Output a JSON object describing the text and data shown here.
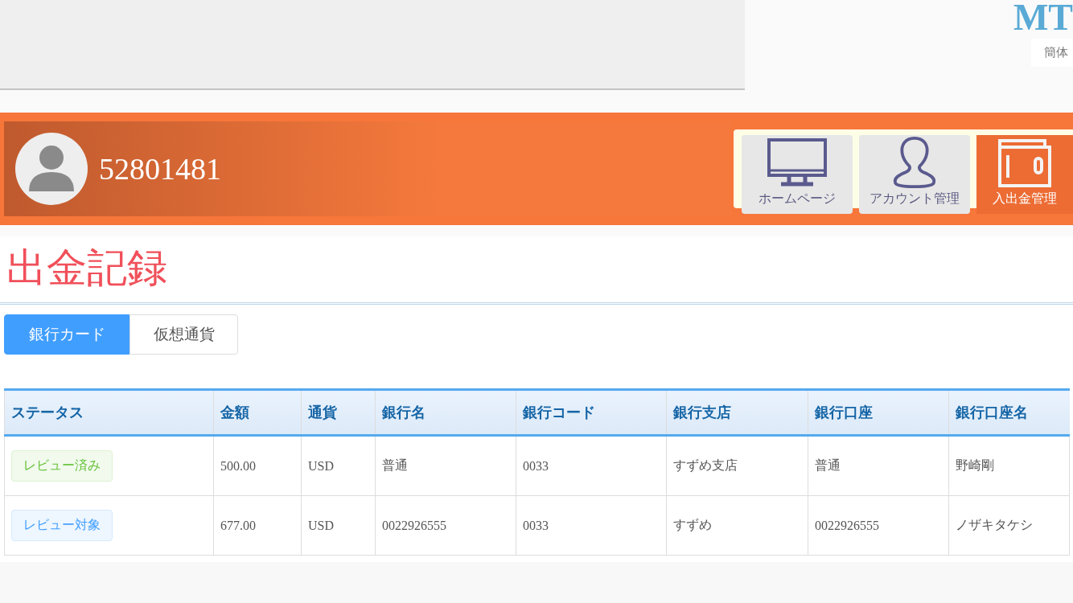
{
  "header": {
    "logo": "MT",
    "language": "簡体"
  },
  "user": {
    "account": "52801481"
  },
  "nav": [
    {
      "label": "ホームページ",
      "kind": "monitor",
      "selected": false
    },
    {
      "label": "アカウント管理",
      "kind": "person",
      "selected": false
    },
    {
      "label": "入出金管理",
      "kind": "wallet",
      "selected": true
    }
  ],
  "page_title": "出金記録",
  "tabs": [
    {
      "label": "銀行カード",
      "selected": true
    },
    {
      "label": "仮想通貨",
      "selected": false
    }
  ],
  "table": {
    "columns": [
      "ステータス",
      "金額",
      "通貨",
      "銀行名",
      "銀行コード",
      "銀行支店",
      "銀行口座",
      "銀行口座名"
    ],
    "rows": [
      {
        "color": "#67c23a",
        "cells": [
          "レビュー済み",
          "500.00",
          "USD",
          "普通",
          "0033",
          "すずめ支店",
          "普通",
          "野崎剛"
        ]
      },
      {
        "color": "#409eff",
        "cells": [
          "レビュー対象",
          "677.00",
          "USD",
          "0022926555",
          "0033",
          "すずめ",
          "0022926555",
          "ノザキタケシ"
        ]
      }
    ]
  }
}
